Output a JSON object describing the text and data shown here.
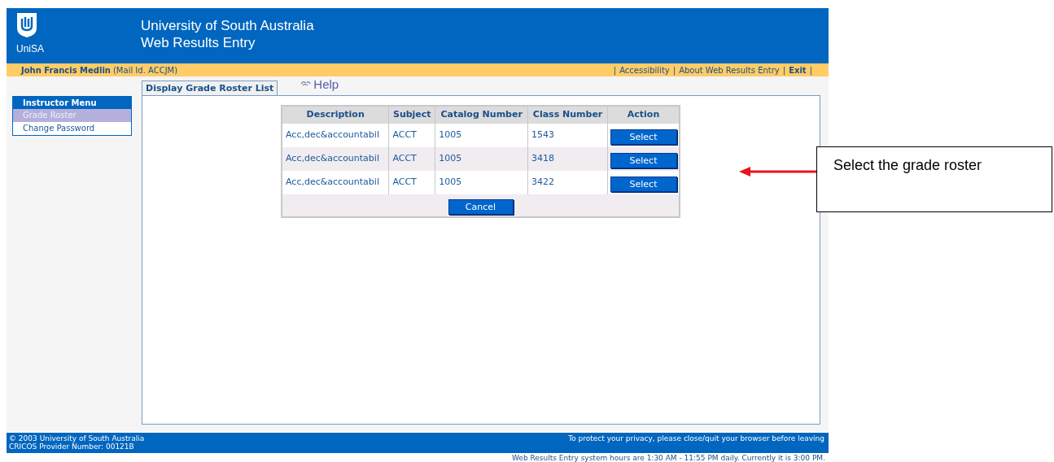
{
  "header": {
    "logo_text": "UniSA",
    "title": "University of South Australia",
    "subtitle": "Web Results Entry"
  },
  "user_bar": {
    "name": "John Francis Medlin",
    "mail_id": "(Mail Id. ACCJM)",
    "separator": "|",
    "links": [
      {
        "label": "Accessibility",
        "bold": false
      },
      {
        "label": "About Web Results Entry",
        "bold": false
      },
      {
        "label": "Exit",
        "bold": true
      }
    ]
  },
  "menu": {
    "title": "Instructor Menu",
    "items": [
      {
        "label": "Grade Roster",
        "selected": true
      },
      {
        "label": "Change Password",
        "selected": false
      }
    ]
  },
  "tabs": [
    {
      "label": "Display Grade Roster List",
      "selected": true
    }
  ],
  "help": "Help",
  "table": {
    "columns": [
      "Description",
      "Subject",
      "Catalog Number",
      "Class Number",
      "Action"
    ],
    "rows": [
      {
        "description": "Acc,dec&accountabil",
        "subject": "ACCT",
        "catalog": "1005",
        "class": "1543",
        "action": "Select"
      },
      {
        "description": "Acc,dec&accountabil",
        "subject": "ACCT",
        "catalog": "1005",
        "class": "3418",
        "action": "Select"
      },
      {
        "description": "Acc,dec&accountabil",
        "subject": "ACCT",
        "catalog": "1005",
        "class": "3422",
        "action": "Select"
      }
    ],
    "cancel": "Cancel"
  },
  "footer": {
    "left": [
      "© 2003 University of South Australia",
      "CRICOS Provider Number: 00121B"
    ],
    "right": "To protect your privacy, please close/quit your browser before leaving",
    "hours": "Web Results Entry system hours are 1:30 AM - 11:55 PM daily. Currently it is 3:00 PM."
  },
  "annotation": "Select the grade roster"
}
